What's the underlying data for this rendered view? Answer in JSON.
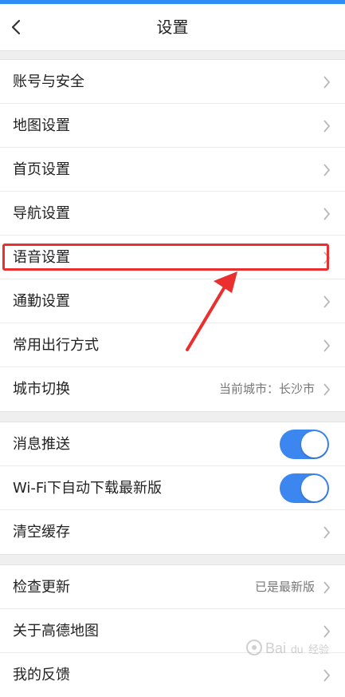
{
  "header": {
    "title": "设置"
  },
  "sections": [
    {
      "items": [
        {
          "label": "账号与安全",
          "type": "link"
        },
        {
          "label": "地图设置",
          "type": "link"
        },
        {
          "label": "首页设置",
          "type": "link"
        },
        {
          "label": "导航设置",
          "type": "link"
        },
        {
          "label": "语音设置",
          "type": "link",
          "highlighted": true
        },
        {
          "label": "通勤设置",
          "type": "link"
        },
        {
          "label": "常用出行方式",
          "type": "link"
        },
        {
          "label": "城市切换",
          "type": "link",
          "value": "当前城市：长沙市"
        }
      ]
    },
    {
      "items": [
        {
          "label": "消息推送",
          "type": "toggle",
          "on": true
        },
        {
          "label": "Wi-Fi下自动下载最新版",
          "type": "toggle",
          "on": true
        },
        {
          "label": "清空缓存",
          "type": "link"
        }
      ]
    },
    {
      "items": [
        {
          "label": "检查更新",
          "type": "link",
          "value": "已是最新版"
        },
        {
          "label": "关于高德地图",
          "type": "link"
        },
        {
          "label": "我的反馈",
          "type": "link"
        }
      ]
    }
  ],
  "colors": {
    "accent": "#3b86ef",
    "highlight": "#ea2f2f",
    "top_strip": "#2f8df5"
  }
}
